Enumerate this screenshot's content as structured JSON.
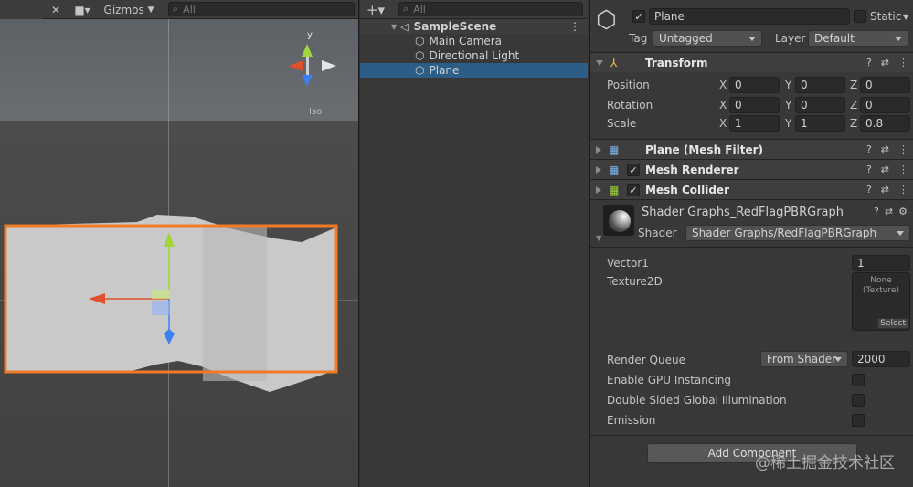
{
  "scene": {
    "toolbar": {
      "gizmos_label": "Gizmos",
      "search_placeholder": "All"
    },
    "persp_label": "Iso",
    "gizmo_axis_y": "y"
  },
  "hierarchy": {
    "search_placeholder": "All",
    "scene_name": "SampleScene",
    "items": [
      {
        "label": "Main Camera"
      },
      {
        "label": "Directional Light"
      },
      {
        "label": "Plane"
      }
    ]
  },
  "inspector": {
    "object_name": "Plane",
    "static_label": "Static",
    "tag_label": "Tag",
    "tag_value": "Untagged",
    "layer_label": "Layer",
    "layer_value": "Default",
    "transform": {
      "title": "Transform",
      "position_label": "Position",
      "rotation_label": "Rotation",
      "scale_label": "Scale",
      "position": {
        "x": "0",
        "y": "0",
        "z": "0"
      },
      "rotation": {
        "x": "0",
        "y": "0",
        "z": "0"
      },
      "scale": {
        "x": "1",
        "y": "1",
        "z": "0.8"
      }
    },
    "axis_x": "X",
    "axis_y": "Y",
    "axis_z": "Z",
    "components": [
      {
        "title": "Plane (Mesh Filter)"
      },
      {
        "title": "Mesh Renderer"
      },
      {
        "title": "Mesh Collider"
      }
    ],
    "material": {
      "name": "Shader Graphs_RedFlagPBRGraph",
      "shader_label": "Shader",
      "shader_value": "Shader Graphs/RedFlagPBRGraph",
      "vector1_label": "Vector1",
      "vector1_value": "1",
      "texture2d_label": "Texture2D",
      "texture_none": "None",
      "texture_type": "(Texture)",
      "texture_select": "Select",
      "render_queue_label": "Render Queue",
      "render_queue_mode": "From Shader",
      "render_queue_value": "2000",
      "gpu_instancing_label": "Enable GPU Instancing",
      "double_sided_gi_label": "Double Sided Global Illumination",
      "emission_label": "Emission"
    },
    "add_component_label": "Add Component"
  },
  "watermark": "@稀土掘金技术社区",
  "colors": {
    "selection": "#2c5d87",
    "selection_outline": "#f07a26",
    "axis_x": "#e0502a",
    "axis_y": "#9fd63b",
    "axis_z": "#3c7ff0"
  }
}
